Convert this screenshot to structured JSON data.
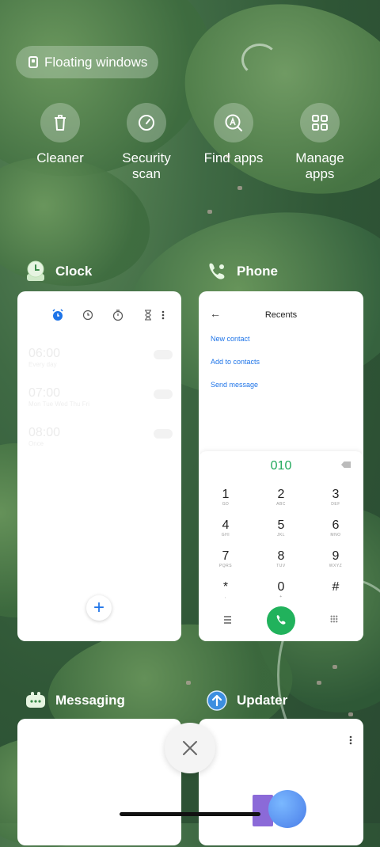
{
  "floating_windows": {
    "label": "Floating windows"
  },
  "quick_actions": [
    {
      "label": "Cleaner",
      "icon": "trash-icon"
    },
    {
      "label": "Security scan",
      "icon": "security-gauge-icon"
    },
    {
      "label": "Find apps",
      "icon": "find-apps-icon"
    },
    {
      "label": "Manage apps",
      "icon": "grid-apps-icon"
    }
  ],
  "recent_apps": {
    "clock": {
      "name": "Clock",
      "alarms": [
        {
          "time": "06:00",
          "sub": "Every day"
        },
        {
          "time": "07:00",
          "sub": "Mon Tue Wed Thu Fri"
        },
        {
          "time": "08:00",
          "sub": "Once"
        }
      ],
      "add_label": "+"
    },
    "phone": {
      "name": "Phone",
      "title": "Recents",
      "back": "←",
      "links": [
        "New contact",
        "Add to contacts",
        "Send message"
      ],
      "dialed_number": "010",
      "keys": [
        {
          "digit": "1",
          "letters": "GD"
        },
        {
          "digit": "2",
          "letters": "ABC"
        },
        {
          "digit": "3",
          "letters": "DEF"
        },
        {
          "digit": "4",
          "letters": "GHI"
        },
        {
          "digit": "5",
          "letters": "JKL"
        },
        {
          "digit": "6",
          "letters": "MNO"
        },
        {
          "digit": "7",
          "letters": "PQRS"
        },
        {
          "digit": "8",
          "letters": "TUV"
        },
        {
          "digit": "9",
          "letters": "WXYZ"
        },
        {
          "digit": "*",
          "letters": ","
        },
        {
          "digit": "0",
          "letters": "+"
        },
        {
          "digit": "#",
          "letters": ""
        }
      ]
    },
    "messaging": {
      "name": "Messaging"
    },
    "updater": {
      "name": "Updater"
    }
  },
  "colors": {
    "accent_blue": "#1e74e8",
    "call_green": "#21b25c",
    "dial_green": "#1fa85a"
  }
}
